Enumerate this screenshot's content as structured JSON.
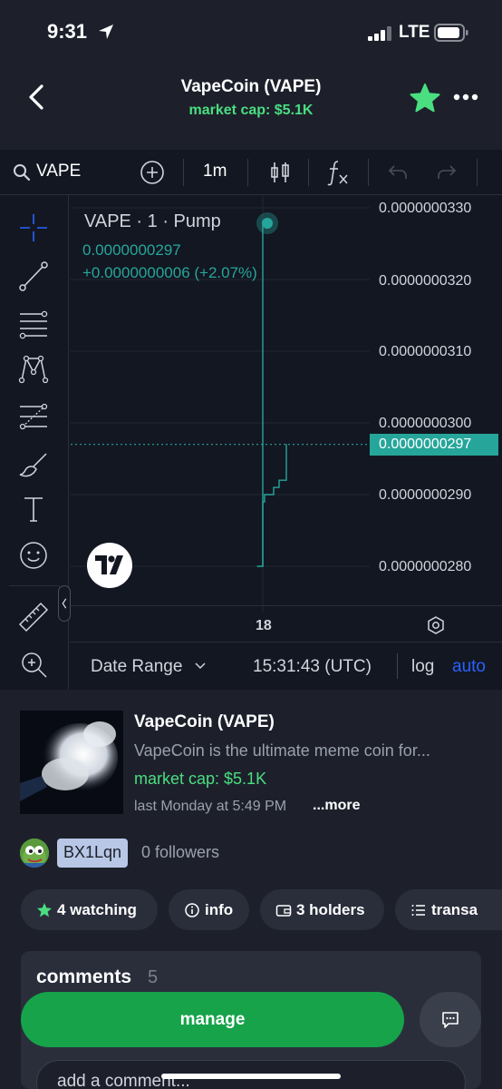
{
  "status_bar": {
    "time": "9:31",
    "network": "LTE"
  },
  "header": {
    "title": "VapeCoin (VAPE)",
    "market_cap": "market cap: $5.1K"
  },
  "chart_toolbar": {
    "symbol": "VAPE",
    "interval": "1m"
  },
  "chart": {
    "legend_name": "VAPE · 1 · Pump",
    "legend_price": "0.0000000297",
    "legend_change": "+0.0000000006 (+2.07%)",
    "current_price_label": "0.0000000297",
    "price_ticks": [
      "0.0000000330",
      "0.0000000320",
      "0.0000000310",
      "0.0000000300",
      "0.0000000290",
      "0.0000000280"
    ],
    "time_label": "18",
    "date_range": "Date Range",
    "clock": "15:31:43 (UTC)",
    "log_label": "log",
    "auto_label": "auto",
    "colors": {
      "up": "#26a69a",
      "auto": "#2962ff",
      "background": "#131722"
    }
  },
  "chart_data": {
    "type": "line",
    "x": [
      "18"
    ],
    "series": [
      {
        "values": [
          2.8e-08,
          2.89e-08,
          2.9e-08,
          2.91e-08,
          2.92e-08,
          2.97e-08
        ]
      }
    ],
    "ylim": [
      2.75e-08,
      3.35e-08
    ],
    "grid": true
  },
  "token": {
    "name": "VapeCoin (VAPE)",
    "description": "VapeCoin is the ultimate meme coin for...",
    "market_cap": "market cap: $5.1K",
    "created": "last Monday at 5:49 PM",
    "more": "...more",
    "creator": "BX1Lqn",
    "followers": "0 followers"
  },
  "pills": {
    "watching": "4 watching",
    "info": "info",
    "holders": "3 holders",
    "transactions": "transa"
  },
  "comments": {
    "title": "comments",
    "count": "5",
    "placeholder": "add a comment..."
  },
  "actions": {
    "manage": "manage"
  },
  "accent": {
    "green": "#4ade80",
    "button_green": "#16a34a"
  },
  "icons": [
    "back-icon",
    "star-icon",
    "more-icon",
    "search-icon",
    "add-icon",
    "candle-icon",
    "fx-icon",
    "undo-icon",
    "redo-icon",
    "crosshair-icon",
    "trendline-icon",
    "fib-icon",
    "pattern-icon",
    "projection-icon",
    "brush-icon",
    "text-icon",
    "emoji-icon",
    "ruler-icon",
    "zoom-icon",
    "settings-icon",
    "chat-icon"
  ]
}
